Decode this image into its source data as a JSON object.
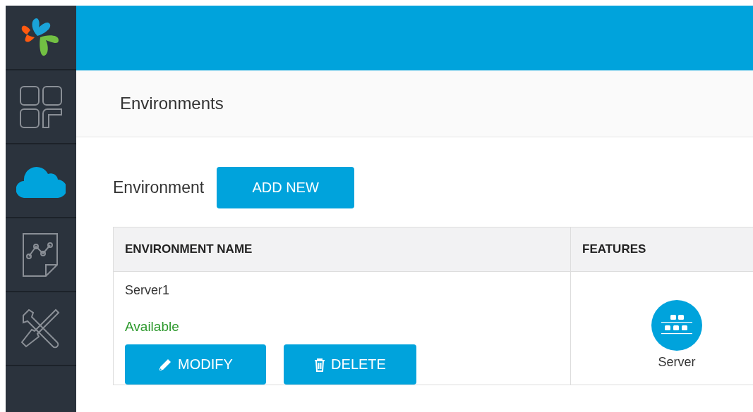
{
  "sidebar": {
    "items": [
      {
        "kind": "apps",
        "selected": false
      },
      {
        "kind": "cloud",
        "selected": true
      },
      {
        "kind": "report",
        "selected": false
      },
      {
        "kind": "tools",
        "selected": false
      }
    ]
  },
  "page_title": "Environments",
  "section": {
    "label": "Environment",
    "add_button": "ADD NEW"
  },
  "table": {
    "columns": [
      "ENVIRONMENT NAME",
      "FEATURES"
    ],
    "rows": [
      {
        "name": "Server1",
        "status": "Available",
        "actions": [
          "MODIFY",
          "DELETE"
        ],
        "features": [
          {
            "label": "Server"
          }
        ]
      }
    ]
  }
}
